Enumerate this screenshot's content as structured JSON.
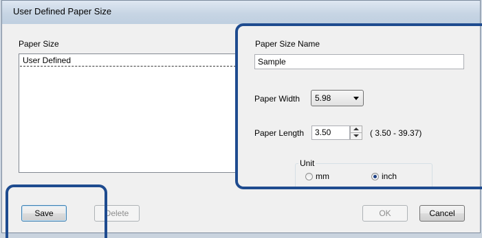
{
  "window": {
    "title": "User Defined Paper Size"
  },
  "paper_size": {
    "label": "Paper Size",
    "items": [
      "User Defined"
    ]
  },
  "paper_size_name": {
    "label": "Paper Size Name",
    "value": "Sample"
  },
  "paper_width": {
    "label": "Paper Width",
    "value": "5.98"
  },
  "paper_length": {
    "label": "Paper Length",
    "value": "3.50",
    "range": "( 3.50 - 39.37)"
  },
  "unit": {
    "label": "Unit",
    "options": [
      "mm",
      "inch"
    ],
    "selected": "inch"
  },
  "buttons": {
    "save": "Save",
    "delete": "Delete",
    "ok": "OK",
    "cancel": "Cancel"
  },
  "colors": {
    "callout": "#1e4b8f",
    "title_bar": "#c7d5e4"
  }
}
